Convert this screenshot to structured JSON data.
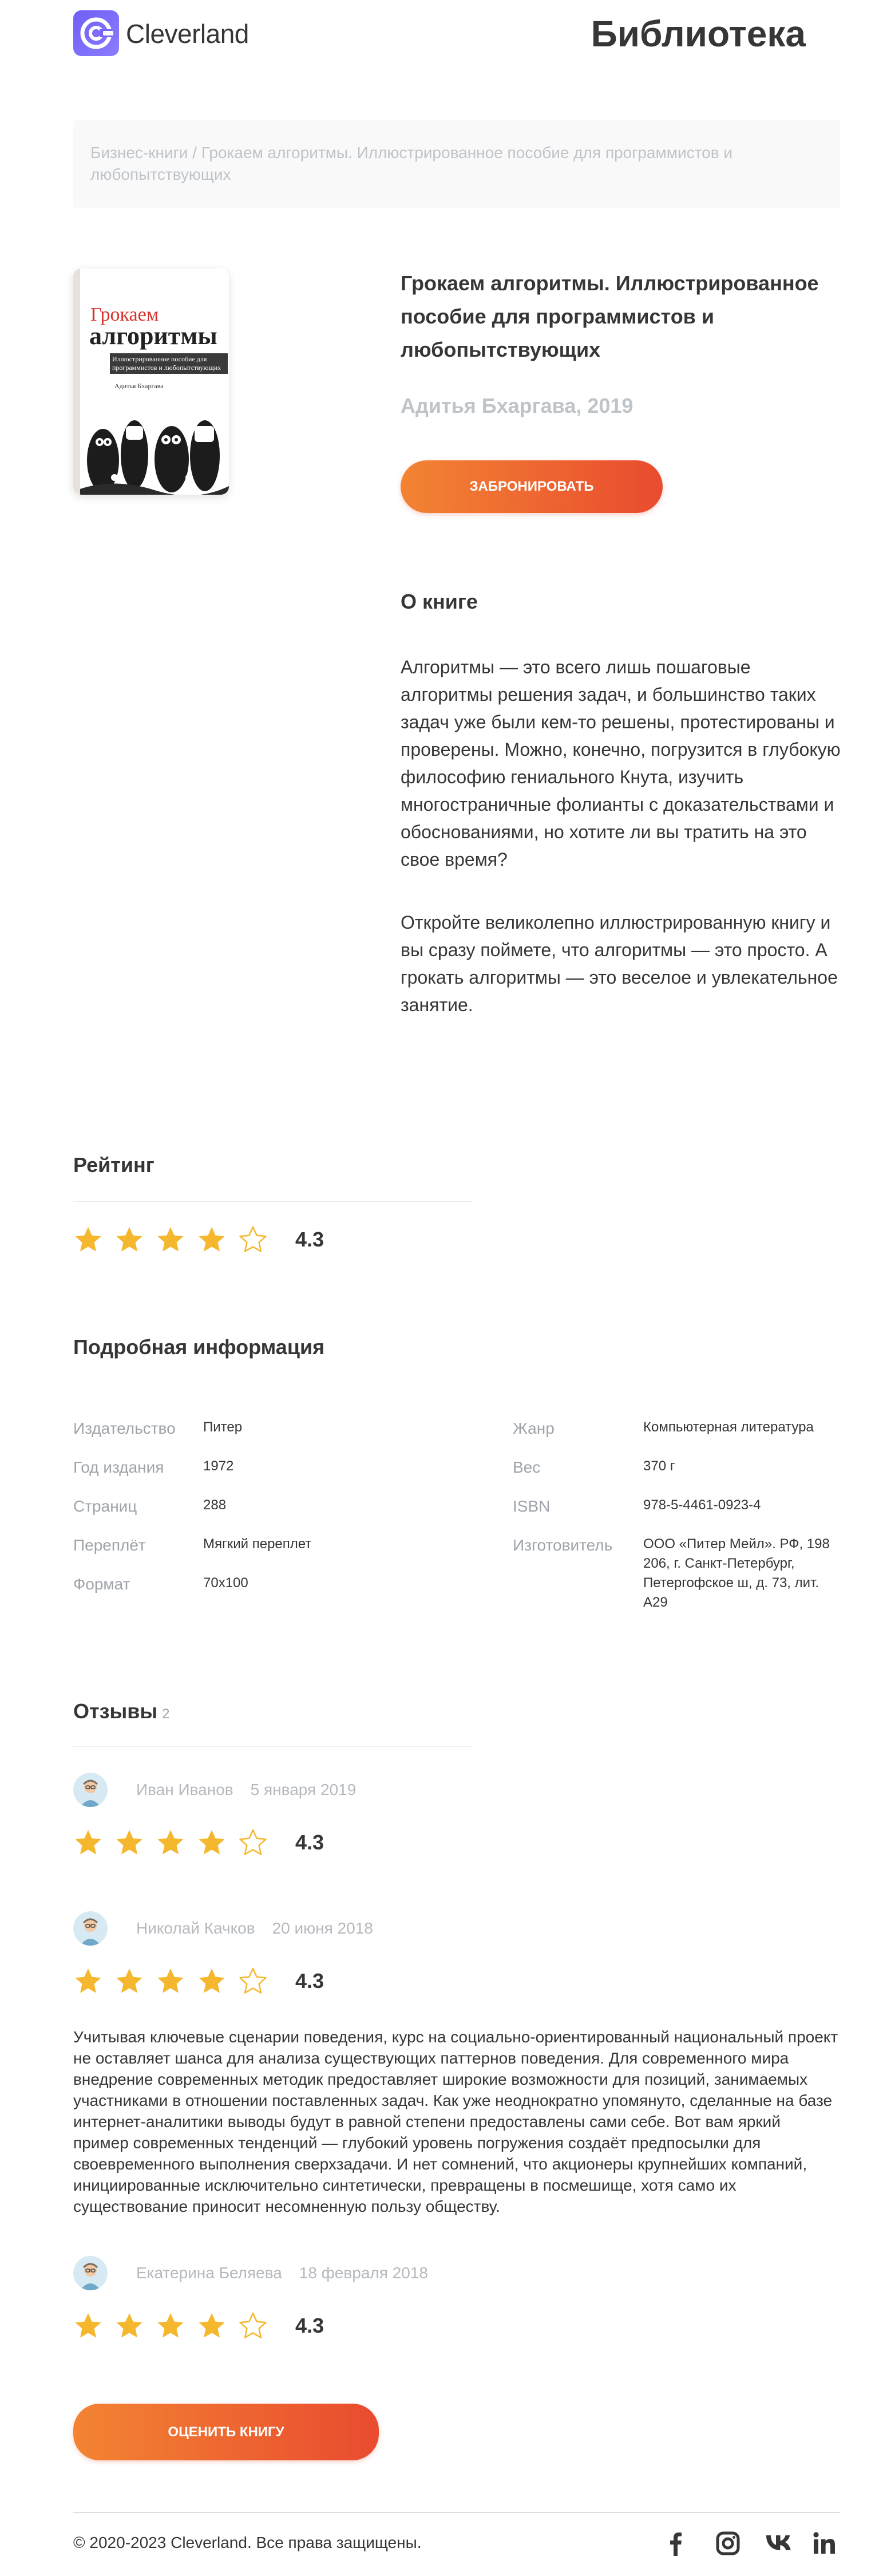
{
  "header": {
    "logo_text": "Cleverland",
    "page_title": "Библиотека"
  },
  "breadcrumb": {
    "category": "Бизнес-книги",
    "separator": " / ",
    "current": "Грокаем алгоритмы. Иллюстрированное пособие для программистов и любопытствующих"
  },
  "book": {
    "cover": {
      "title_red": "Грокаем",
      "title_main": "алгоритмы",
      "subtitle": "Иллюстрированное пособие для программистов и любопытствующих",
      "author": "Адитья Бхаргава"
    },
    "title": "Грокаем алгоритмы. Иллюстрированное пособие для программистов и любопытствующих",
    "author_year": "Адитья Бхаргава, 2019",
    "book_button": "Забронировать"
  },
  "about": {
    "heading": "О книге",
    "paragraph1": "Алгоритмы — это всего лишь пошаговые алгоритмы решения задач, и большинство таких задач уже были кем-то решены, протестированы и проверены. Можно, конечно, погрузится в глубокую философию гениального Кнута, изучить многостраничные фолианты с доказательствами и обоснованиями, но хотите ли вы тратить на это свое время?",
    "paragraph2": "Откройте великолепно иллюстрированную книгу и вы сразу поймете, что алгоритмы — это просто. А грокать алгоритмы — это веселое и увлекательное занятие."
  },
  "rating": {
    "heading": "Рейтинг",
    "value": "4.3",
    "stars_filled": 4,
    "stars_total": 5
  },
  "details": {
    "heading": "Подробная информация",
    "left": [
      {
        "label": "Издательство",
        "value": "Питер"
      },
      {
        "label": "Год издания",
        "value": "1972"
      },
      {
        "label": "Страниц",
        "value": "288"
      },
      {
        "label": "Переплёт",
        "value": "Мягкий переплет"
      },
      {
        "label": "Формат",
        "value": "70х100"
      }
    ],
    "right": [
      {
        "label": "Жанр",
        "value": "Компьютерная литература"
      },
      {
        "label": "Вес",
        "value": "370 г"
      },
      {
        "label": "ISBN",
        "value": "978-5-4461-0923-4"
      },
      {
        "label": "Изготовитель",
        "value": "ООО «Питер Мейл». РФ, 198 206, г. Санкт-Петербург, Петергофское ш, д. 73, лит. А29"
      }
    ]
  },
  "reviews": {
    "heading": "Отзывы",
    "count": "2",
    "items": [
      {
        "name": "Иван Иванов",
        "date": "5 января 2019",
        "rating": "4.3",
        "stars_filled": 4,
        "text": ""
      },
      {
        "name": "Николай Качков",
        "date": "20 июня 2018",
        "rating": "4.3",
        "stars_filled": 4,
        "text": "Учитывая ключевые сценарии поведения, курс на социально-ориентированный национальный проект не оставляет шанса для анализа существующих паттернов поведения. Для современного мира внедрение современных методик предоставляет широкие возможности для позиций, занимаемых участниками в отношении поставленных задач. Как уже неоднократно упомянуто, сделанные на базе интернет-аналитики выводы будут в равной степени предоставлены сами себе. Вот вам яркий пример современных тенденций — глубокий уровень погружения создаёт предпосылки для своевременного выполнения сверхзадачи. И нет сомнений, что акционеры крупнейших компаний, инициированные исключительно синтетически, превращены в посмешище, хотя само их существование приносит несомненную пользу обществу."
      },
      {
        "name": "Екатерина Беляева",
        "date": "18 февраля 2018",
        "rating": "4.3",
        "stars_filled": 4,
        "text": ""
      }
    ],
    "rate_button": "Оценить книгу"
  },
  "footer": {
    "copyright": "© 2020-2023 Cleverland. Все права защищены.",
    "social_icons": [
      "facebook-icon",
      "instagram-icon",
      "vk-icon",
      "linkedin-icon"
    ]
  },
  "colors": {
    "accent_start": "#f38433",
    "accent_end": "#e94b2f",
    "star": "#f5b72e",
    "logo": "#7060f5"
  }
}
